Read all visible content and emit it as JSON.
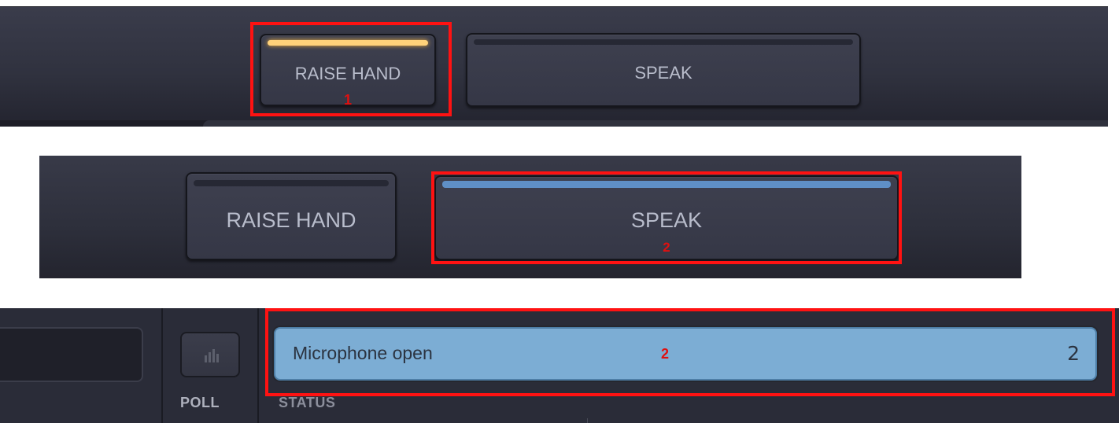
{
  "panel_1": {
    "raise_hand": {
      "label": "RAISE HAND",
      "state": "active",
      "indicator_color": "#ffd27a",
      "annotation": "1"
    },
    "speak": {
      "label": "SPEAK",
      "state": "inactive"
    }
  },
  "panel_2": {
    "raise_hand": {
      "label": "RAISE HAND",
      "state": "inactive"
    },
    "speak": {
      "label": "SPEAK",
      "state": "active",
      "indicator_color": "#5f8fc6",
      "annotation": "2"
    }
  },
  "panel_3": {
    "poll": {
      "label": "POLL",
      "icon": "bar-chart-icon"
    },
    "status": {
      "label": "STATUS",
      "text": "Microphone open",
      "count": "2",
      "annotation": "2",
      "color": "#7cadd4"
    }
  },
  "colors": {
    "highlight": "#ff1212",
    "panel_bg": "#30323f"
  }
}
